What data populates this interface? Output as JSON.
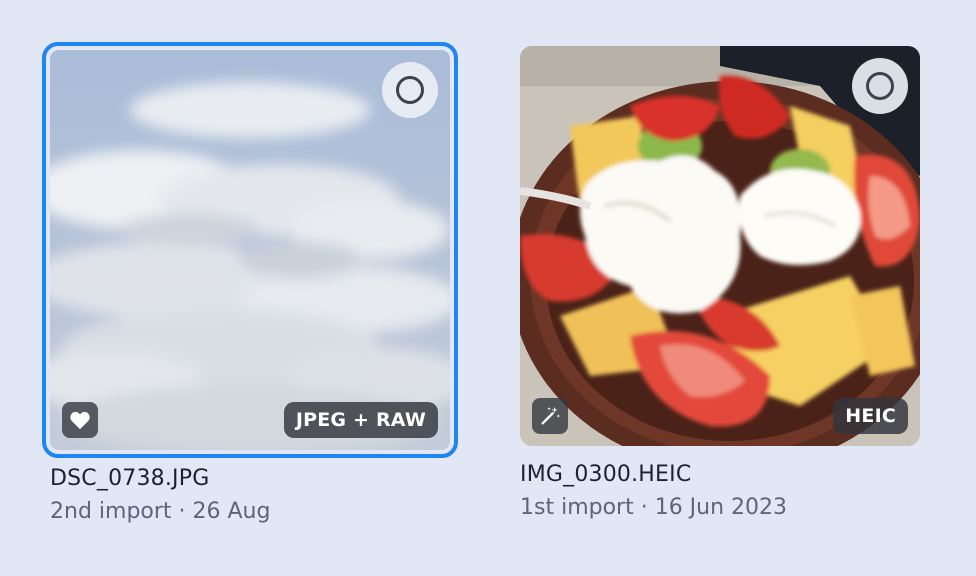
{
  "photos": [
    {
      "filename": "DSC_0738.JPG",
      "meta": "2nd import · 26 Aug",
      "format_badge": "JPEG + RAW",
      "status_icon": "heart-icon",
      "selected": true
    },
    {
      "filename": "IMG_0300.HEIC",
      "meta": "1st import · 16 Jun 2023",
      "format_badge": "HEIC",
      "status_icon": "magic-wand-icon",
      "selected": false
    }
  ],
  "colors": {
    "background": "#e1e7f4",
    "selection_border": "#1e86f0",
    "badge_bg": "#32343c"
  }
}
